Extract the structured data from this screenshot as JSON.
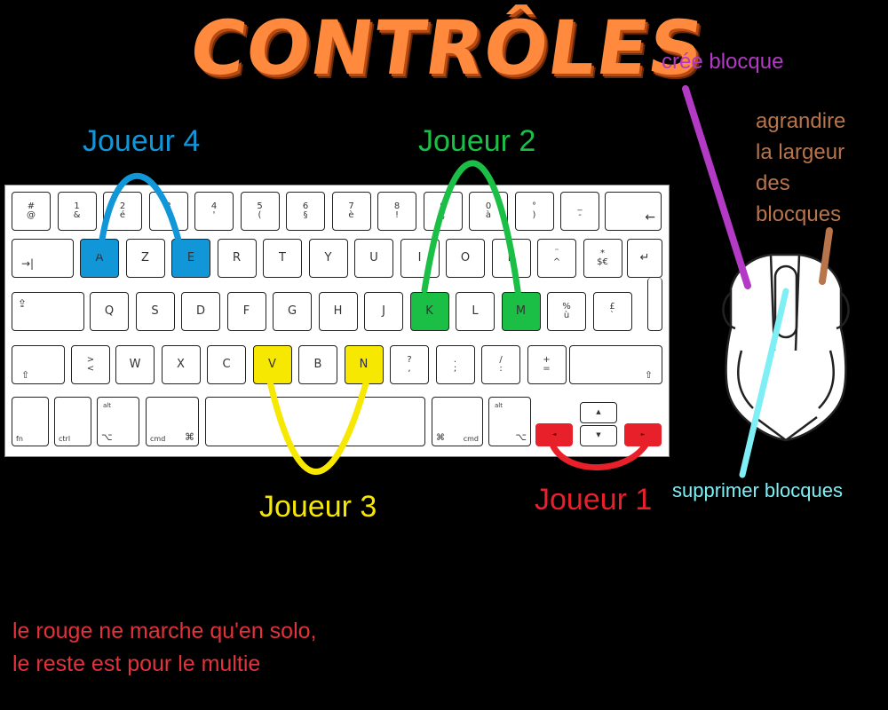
{
  "title": "CONTRÔLES",
  "players": {
    "p4": {
      "label": "Joueur 4",
      "color": "#1196d8"
    },
    "p2": {
      "label": "Joueur 2",
      "color": "#1cbf46"
    },
    "p3": {
      "label": "Joueur 3",
      "color": "#f6e800"
    },
    "p1": {
      "label": "Joueur 1",
      "color": "#e8202a"
    }
  },
  "mouse": {
    "left_click": {
      "label": "crée blocque",
      "color": "#b23ac4"
    },
    "right_click": {
      "lines": [
        "agrandire",
        "la largeur",
        "des",
        "blocques"
      ],
      "color": "#b8744a"
    },
    "wheel": {
      "label": "supprimer blocques",
      "color": "#7ef0f5"
    }
  },
  "note": {
    "line1": "le rouge ne marche qu'en solo,",
    "line2": "le reste est pour le multie",
    "color": "#e2323b"
  },
  "keyboard": {
    "row1": [
      {
        "t": "#",
        "b": "@"
      },
      {
        "t": "1",
        "b": "&"
      },
      {
        "t": "2",
        "b": "é"
      },
      {
        "t": "3",
        "b": "\""
      },
      {
        "t": "4",
        "b": "'"
      },
      {
        "t": "5",
        "b": "("
      },
      {
        "t": "6",
        "b": "§"
      },
      {
        "t": "7",
        "b": "è"
      },
      {
        "t": "8",
        "b": "!"
      },
      {
        "t": "9",
        "b": "ç"
      },
      {
        "t": "0",
        "b": "à"
      },
      {
        "t": "°",
        "b": ")"
      },
      {
        "t": "_",
        "b": "-"
      }
    ],
    "backspace": "←",
    "tab": "→|",
    "row2": [
      "A",
      "Z",
      "E",
      "R",
      "T",
      "Y",
      "U",
      "I",
      "O",
      "P"
    ],
    "row2_extra": [
      {
        "t": "¨",
        "b": "^"
      },
      {
        "t": "*",
        "b": "$€"
      }
    ],
    "enter": "↵",
    "caps": "⇪",
    "row3": [
      "Q",
      "S",
      "D",
      "F",
      "G",
      "H",
      "J",
      "K",
      "L",
      "M"
    ],
    "row3_extra": [
      {
        "t": "%",
        "b": "ù"
      },
      {
        "t": "£",
        "b": "`"
      }
    ],
    "shift": "⇧",
    "row4_first": {
      "t": ">",
      "b": "<"
    },
    "row4": [
      "W",
      "X",
      "C",
      "V",
      "B",
      "N"
    ],
    "row4_extra": [
      {
        "t": "?",
        "b": ","
      },
      {
        "t": ".",
        "b": ";"
      },
      {
        "t": "/",
        "b": ":"
      },
      {
        "t": "+",
        "b": "="
      }
    ],
    "fn": "fn",
    "ctrl": "ctrl",
    "alt_sym": "⌥",
    "alt_top": "alt",
    "cmd": "cmd",
    "cmd_sym": "⌘",
    "arrows": {
      "up": "▲",
      "down": "▼",
      "left": "◄",
      "right": "►"
    }
  }
}
